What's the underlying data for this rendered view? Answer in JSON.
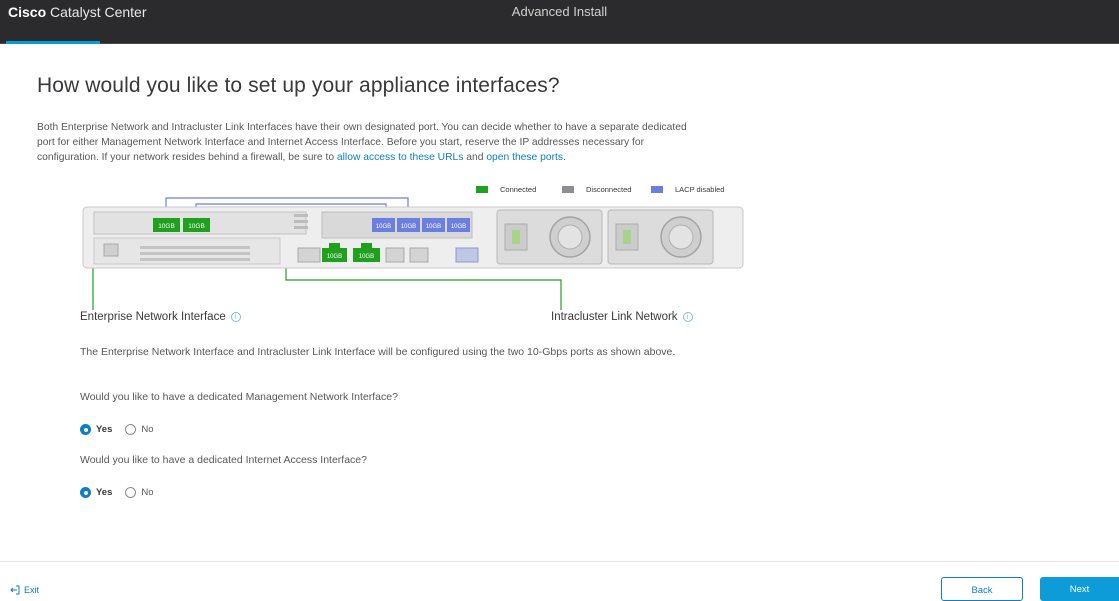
{
  "header": {
    "brand_bold": "Cisco",
    "brand_rest": " Catalyst Center",
    "title": "Advanced Install"
  },
  "main": {
    "heading": "How would you like to set up your appliance interfaces?",
    "intro": {
      "text_1": "Both Enterprise Network and Intracluster Link Interfaces have their own designated port. You can decide whether to have a separate dedicated port for either Management Network Interface and Internet Access Interface. Before you start, reserve the IP addresses necessary for configuration. If your network resides behind a firewall, be sure to ",
      "link_urls": "allow access to these URLs",
      "text_2": " and ",
      "link_ports": "open these ports",
      "text_3": "."
    },
    "legend": [
      {
        "label": "Connected",
        "color": "#1fa01f"
      },
      {
        "label": "Disconnected",
        "color": "#8e8e90"
      },
      {
        "label": "LACP disabled",
        "color": "#6b7fe0"
      }
    ],
    "diagram": {
      "port_label": "10GB"
    },
    "enterprise_label": "Enterprise Network Interface",
    "intracluster_label": "Intracluster Link Network",
    "info_glyph": "i",
    "config_note": "The Enterprise Network Interface and Intracluster Link Interface will be configured using the two 10-Gbps ports as shown above.",
    "q_management": "Would you like to have a dedicated Management Network Interface?",
    "q_internet": "Would you like to have a dedicated Internet Access Interface?",
    "yes_label": "Yes",
    "no_label": "No"
  },
  "footer": {
    "exit_label": "Exit",
    "back_label": "Back",
    "next_label": "Next"
  },
  "colors": {
    "accent": "#049fd9",
    "link": "#0d7fc2",
    "connected": "#1fa01f",
    "lacp": "#6b7fe0"
  }
}
